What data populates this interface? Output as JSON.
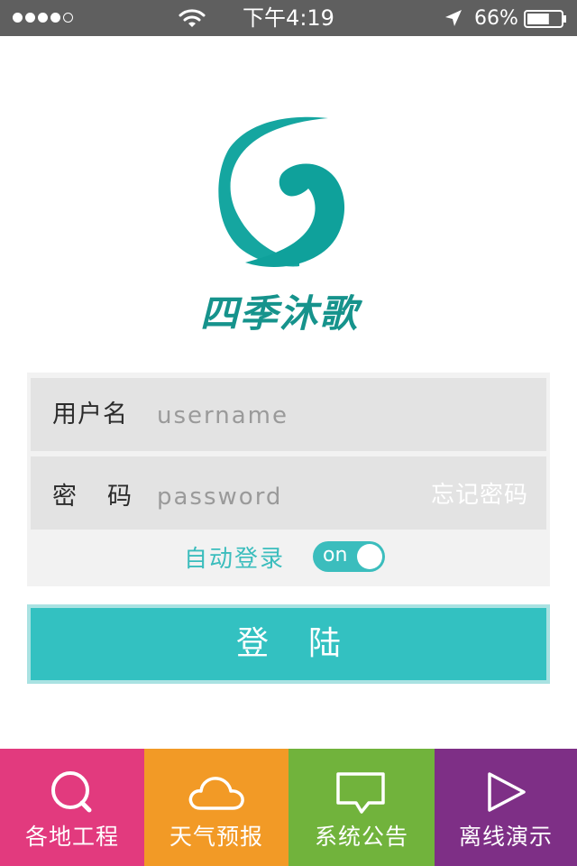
{
  "status_bar": {
    "time": "下午4:19",
    "battery": "66%",
    "signal_bars": 4,
    "signal_max": 5,
    "battery_level": 0.66,
    "icons": [
      "wifi-icon",
      "location-arrow-icon",
      "battery-icon"
    ]
  },
  "brand": {
    "name": "四季沐歌",
    "color": "#16938c",
    "logo_icon": "swirl-logo-icon"
  },
  "login_form": {
    "username_label": "用户名",
    "username_placeholder": "username",
    "username_value": "",
    "password_label": "密码",
    "password_placeholder": "password",
    "password_value": "",
    "forgot_password": "忘记密码",
    "auto_login_label": "自动登录",
    "auto_login_toggle": "on",
    "auto_login_enabled": true,
    "login_button": "登陆",
    "accent_color": "#33c1c1"
  },
  "tabs": [
    {
      "label": "各地工程",
      "icon": "search-icon",
      "color": "#e23a7e"
    },
    {
      "label": "天气预报",
      "icon": "cloud-icon",
      "color": "#f29a26"
    },
    {
      "label": "系统公告",
      "icon": "message-icon",
      "color": "#71b33c"
    },
    {
      "label": "离线演示",
      "icon": "play-icon",
      "color": "#7e2f86"
    }
  ]
}
